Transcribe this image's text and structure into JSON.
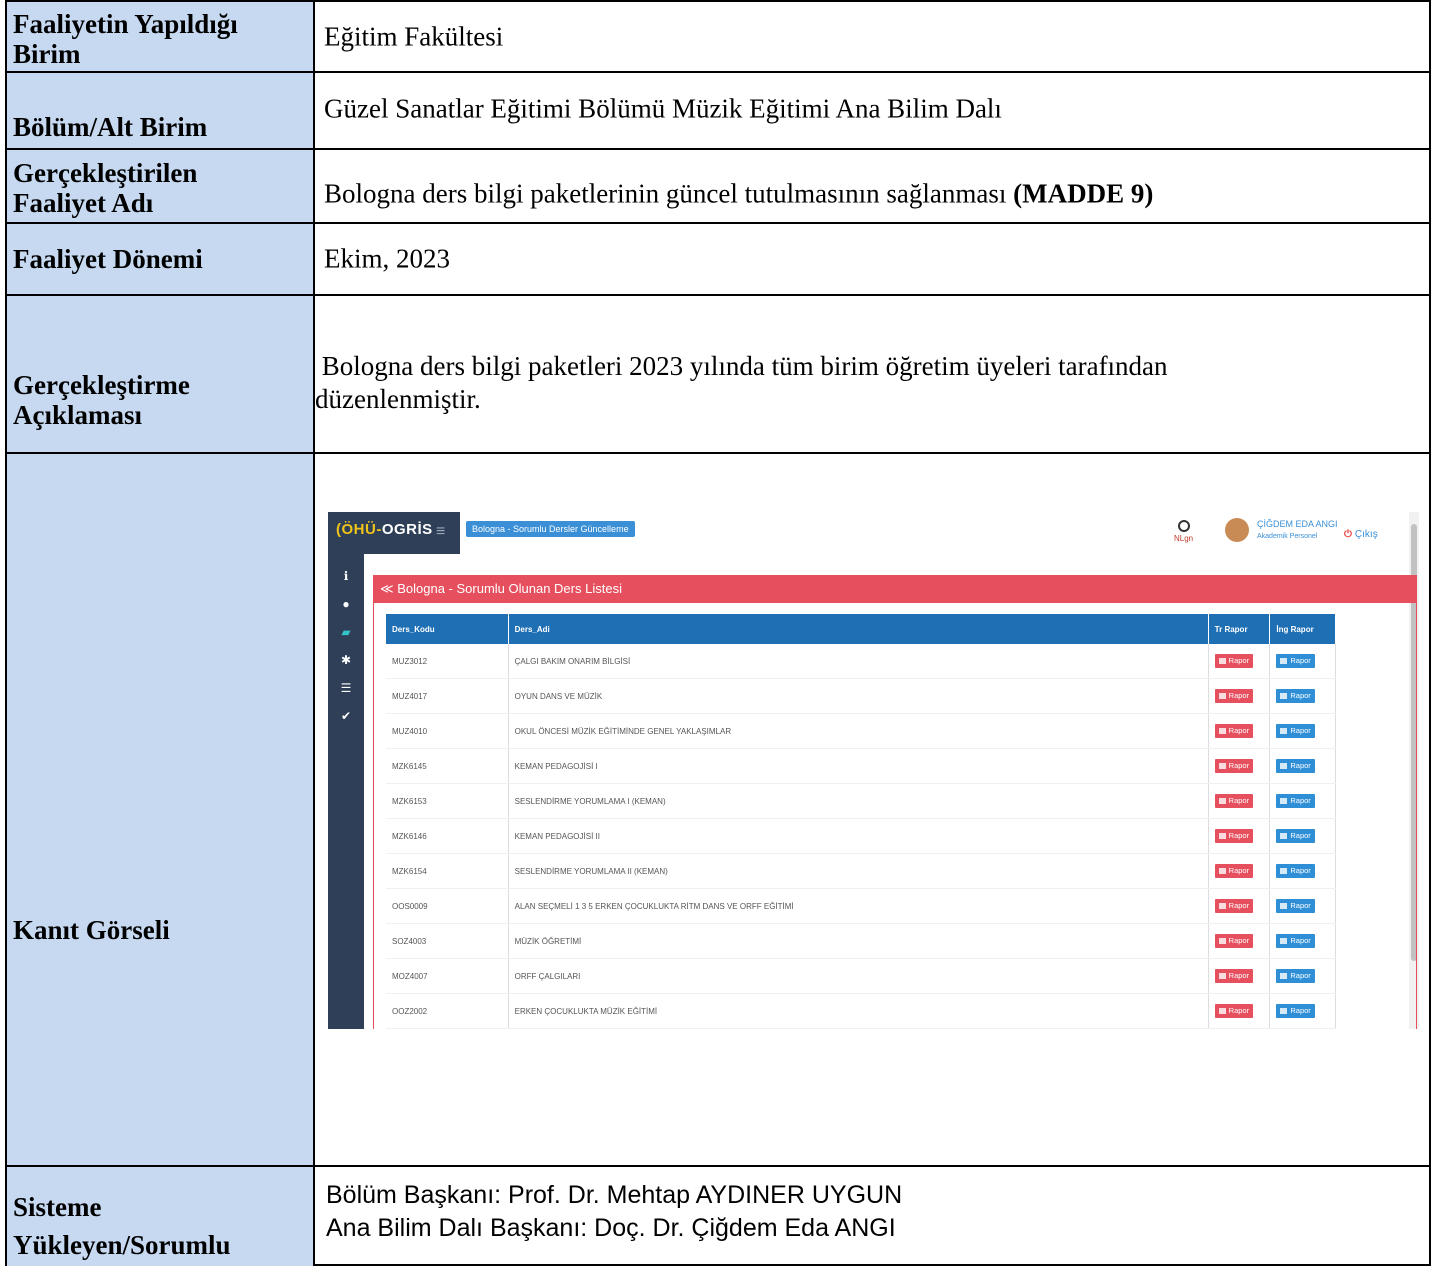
{
  "rows": [
    {
      "label_lines": [
        "Faaliyetin Yapıldığı",
        "Birim"
      ],
      "value": "Eğitim Fakültesi"
    },
    {
      "label_lines": [
        "Bölüm/Alt Birim"
      ],
      "value": "Güzel Sanatlar Eğitimi Bölümü Müzik Eğitimi Ana Bilim Dalı"
    },
    {
      "label_lines": [
        "Gerçekleştirilen",
        "Faaliyet Adı"
      ],
      "value": "Bologna ders bilgi paketlerinin güncel tutulmasının sağlanması ",
      "value_bold": "(MADDE 9)"
    },
    {
      "label_lines": [
        "Faaliyet Dönemi"
      ],
      "value": "Ekim, 2023"
    },
    {
      "label_lines": [
        "Gerçekleştirme",
        "Açıklaması"
      ],
      "value_lines": [
        " Bologna ders bilgi paketleri 2023 yılında tüm birim öğretim üyeleri tarafından",
        "düzenlenmiştir."
      ]
    },
    {
      "label_lines": [
        "Kanıt Görseli"
      ]
    },
    {
      "label_lines": [
        "Sisteme",
        "Yükleyen/Sorumlu"
      ],
      "value_lines": [
        "Bölüm Başkanı: Prof. Dr. Mehtap AYDINER UYGUN",
        "Ana Bilim Dalı Başkanı: Doç. Dr. Çiğdem Eda ANGI"
      ]
    }
  ],
  "screenshot": {
    "logo_prefix": "(ÖHÜ-",
    "logo_main": "OGRİS",
    "breadcrumb": "Bologna - Sorumlu Dersler Güncelleme",
    "nlgn": "NLgn",
    "user_name": "ÇİĞDEM EDA ANGI",
    "user_role": "Akademik Personel",
    "logout": "Çıkış",
    "sidenav_icons": [
      "info-icon",
      "user-icon",
      "book-icon",
      "asterisk-icon",
      "list-icon",
      "check-icon"
    ],
    "panel_title": "Bologna - Sorumlu Olunan Ders Listesi",
    "columns": [
      "Ders_Kodu",
      "Ders_Adi",
      "Tr Rapor",
      "İng Rapor"
    ],
    "button_label": "Rapor",
    "courses": [
      {
        "code": "MUZ3012",
        "name": "ÇALGI BAKIM ONARIM BİLGİSİ"
      },
      {
        "code": "MUZ4017",
        "name": "OYUN DANS VE MÜZİK"
      },
      {
        "code": "MUZ4010",
        "name": "OKUL ÖNCESİ MÜZİK EĞİTİMİNDE GENEL YAKLAŞIMLAR"
      },
      {
        "code": "MZK6145",
        "name": "KEMAN PEDAGOJİSİ I"
      },
      {
        "code": "MZK6153",
        "name": "SESLENDİRME YORUMLAMA I (KEMAN)"
      },
      {
        "code": "MZK6146",
        "name": "KEMAN PEDAGOJİSİ II"
      },
      {
        "code": "MZK6154",
        "name": "SESLENDİRME YORUMLAMA II (KEMAN)"
      },
      {
        "code": "OOS0009",
        "name": "ALAN SEÇMELİ 1 3 5 ERKEN ÇOCUKLUKTA RİTM DANS VE ORFF EĞİTİMİ"
      },
      {
        "code": "SOZ4003",
        "name": "MÜZİK ÖĞRETİMİ"
      },
      {
        "code": "MOZ4007",
        "name": "ORFF ÇALGILARI"
      },
      {
        "code": "OOZ2002",
        "name": "ERKEN ÇOCUKLUKTA MÜZİK EĞİTİMİ"
      }
    ],
    "colors": {
      "sidebar": "#2f3f57",
      "panel_header": "#e6505e",
      "table_header": "#1f6fb5",
      "breadcrumb": "#3a8fd6"
    }
  }
}
